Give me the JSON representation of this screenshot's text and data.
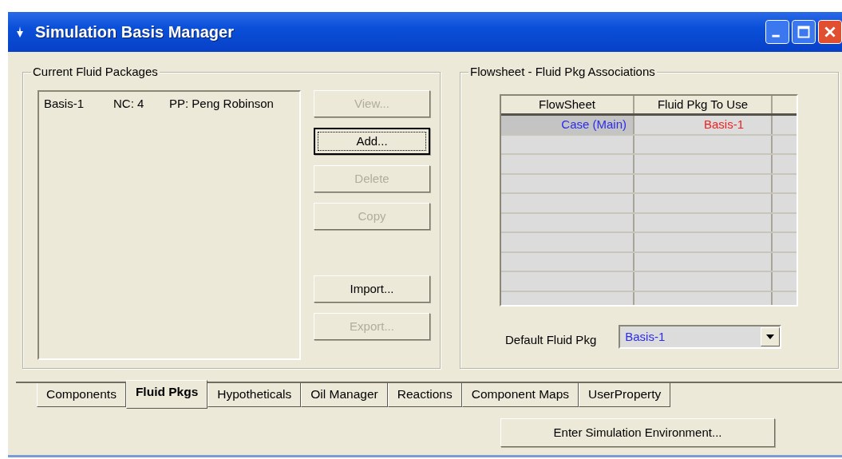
{
  "window": {
    "title": "Simulation Basis Manager"
  },
  "current_fluid_packages": {
    "title": "Current Fluid Packages",
    "items": [
      {
        "name": "Basis-1",
        "components": "NC: 4",
        "property_package": "PP: Peng Robinson",
        "selected": false
      }
    ],
    "buttons": [
      {
        "label": "View...",
        "disabled": true,
        "focused": false
      },
      {
        "label": "Add...",
        "disabled": false,
        "focused": true
      },
      {
        "label": "Delete",
        "disabled": true,
        "focused": false
      },
      {
        "label": "Copy",
        "disabled": true,
        "focused": false
      },
      {
        "label": "Import...",
        "disabled": false,
        "focused": false
      },
      {
        "label": "Export...",
        "disabled": true,
        "focused": false
      }
    ]
  },
  "associations": {
    "title": "Flowsheet - Fluid Pkg Associations",
    "table": {
      "columns": [
        "FlowSheet",
        "Fluid Pkg To Use"
      ],
      "rows": [
        {
          "selected": true,
          "cells": [
            {
              "text": "Case (Main)",
              "color": "#2a2af0"
            },
            {
              "text": "Basis-1",
              "color": "#f02020"
            }
          ]
        }
      ]
    },
    "default_label": "Default Fluid Pkg",
    "default_value": "Basis-1"
  },
  "tabs": [
    {
      "label": "Components",
      "selected": false
    },
    {
      "label": "Fluid Pkgs",
      "selected": true
    },
    {
      "label": "Hypotheticals",
      "selected": false
    },
    {
      "label": "Oil Manager",
      "selected": false
    },
    {
      "label": "Reactions",
      "selected": false
    },
    {
      "label": "Component Maps",
      "selected": false
    },
    {
      "label": "UserProperty",
      "selected": false
    }
  ],
  "enter_button": {
    "label": "Enter Simulation Environment..."
  }
}
